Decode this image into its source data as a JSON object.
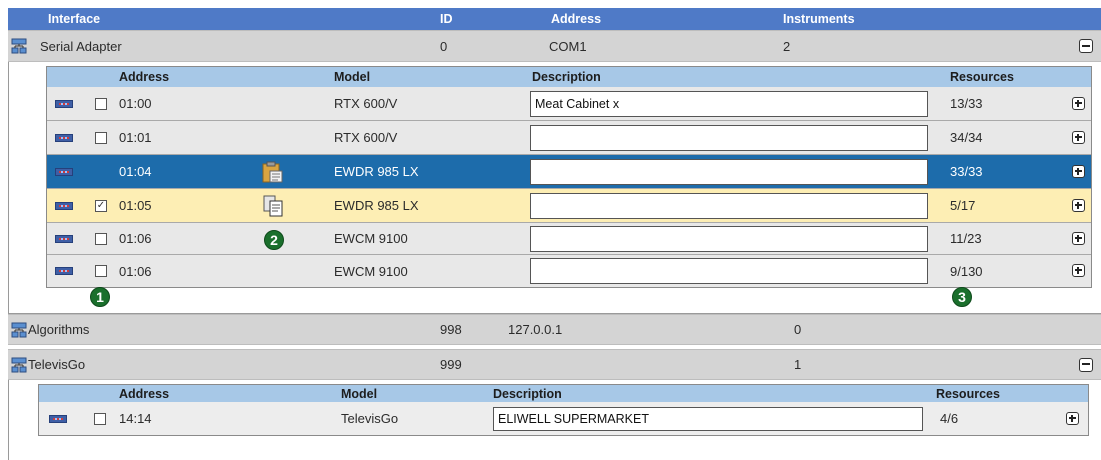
{
  "header": {
    "interface": "Interface",
    "id": "ID",
    "address": "Address",
    "instruments": "Instruments"
  },
  "serial": {
    "name": "Serial Adapter",
    "id": "0",
    "address": "COM1",
    "instruments": "2",
    "columns": {
      "address": "Address",
      "model": "Model",
      "description": "Description",
      "resources": "Resources"
    },
    "rows": [
      {
        "checked": false,
        "address": "01:00",
        "model": "RTX 600/V",
        "description": "Meat Cabinet x",
        "resources": "13/33",
        "state": "normal"
      },
      {
        "checked": false,
        "address": "01:01",
        "model": "RTX 600/V",
        "description": "",
        "resources": "34/34",
        "state": "normal"
      },
      {
        "checked": false,
        "address": "01:04",
        "model": "EWDR 985 LX",
        "description": "",
        "resources": "33/33",
        "state": "selected"
      },
      {
        "checked": true,
        "address": "01:05",
        "model": "EWDR 985 LX",
        "description": "",
        "resources": "5/17",
        "state": "highlighted"
      },
      {
        "checked": false,
        "address": "01:06",
        "model": "EWCM 9100",
        "description": "",
        "resources": "11/23",
        "state": "normal"
      },
      {
        "checked": false,
        "address": "01:06",
        "model": "EWCM 9100",
        "description": "",
        "resources": "9/130",
        "state": "normal"
      }
    ]
  },
  "algorithms": {
    "name": "Algorithms",
    "id": "998",
    "address": "127.0.0.1",
    "instruments": "0"
  },
  "televis": {
    "name": "TelevisGo",
    "id": "999",
    "address": "",
    "instruments": "1",
    "columns": {
      "address": "Address",
      "model": "Model",
      "description": "Description",
      "resources": "Resources"
    },
    "rows": [
      {
        "checked": false,
        "address": "14:14",
        "model": "TelevisGo",
        "description": "ELIWELL SUPERMARKET",
        "resources": "4/6",
        "state": "plain"
      }
    ]
  },
  "callouts": {
    "one": "1",
    "two": "2",
    "three": "3"
  },
  "icons": {
    "interface": "network-adapter-icon",
    "device": "instrument-device-icon",
    "clipboard": "clipboard-paste-icon",
    "copy": "copy-documents-icon",
    "collapse": "collapse-minus-icon",
    "expand": "expand-plus-icon"
  },
  "colors": {
    "header": "#4f7ac7",
    "subheader": "#a7c8e7",
    "selected": "#1d6cab",
    "highlight": "#fdeeb4",
    "callout": "#1a6f2c"
  }
}
